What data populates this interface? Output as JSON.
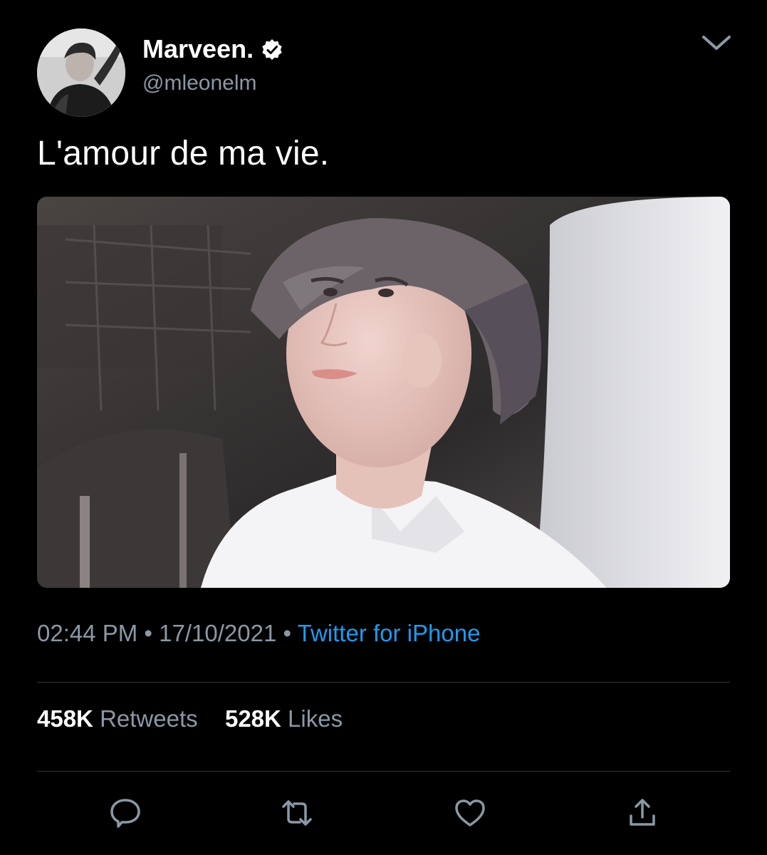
{
  "author": {
    "display_name": "Marveen.",
    "handle": "@mleonelm",
    "verified": true
  },
  "tweet": {
    "text": "L'amour de ma vie."
  },
  "meta": {
    "time": "02:44 PM",
    "separator": "•",
    "date": "17/10/2021",
    "source": "Twitter for iPhone"
  },
  "stats": {
    "retweets_count": "458K",
    "retweets_label": "Retweets",
    "likes_count": "528K",
    "likes_label": "Likes"
  },
  "icons": {
    "verified": "verified-badge-icon",
    "more": "chevron-down-icon",
    "reply": "reply-icon",
    "retweet": "retweet-icon",
    "like": "heart-icon",
    "share": "share-icon"
  },
  "colors": {
    "background": "#000000",
    "link": "#1d9bf0",
    "muted": "#8b98a5",
    "divider": "#2f3336"
  }
}
